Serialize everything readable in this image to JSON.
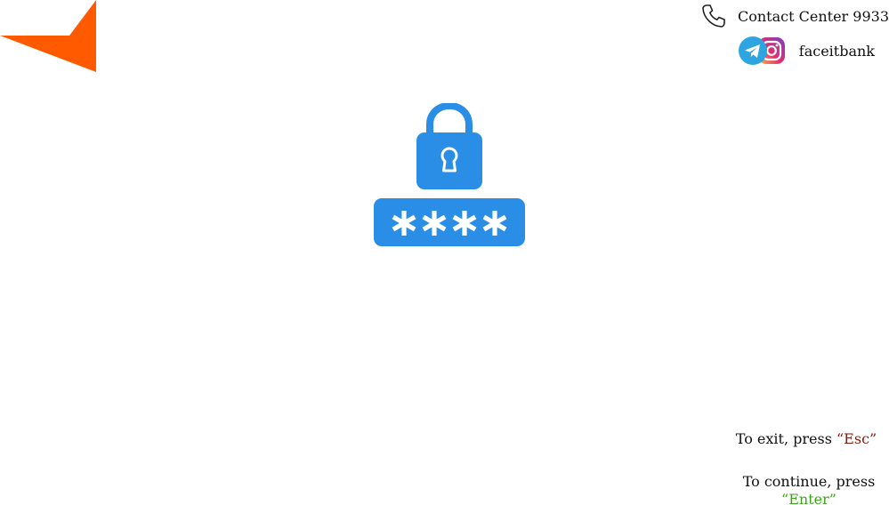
{
  "brand": {
    "accent_color": "#ff5a00",
    "logo_icon": "arrow-chevron-logo"
  },
  "contact": {
    "icon": "phone-icon",
    "label": "Contact Center 9933"
  },
  "social": {
    "icons": [
      "telegram-icon",
      "instagram-icon"
    ],
    "handle": "faceitbank"
  },
  "main": {
    "illustration": "lock-pin-icon",
    "accent_color": "#2a8ee6",
    "pin_mask": "****"
  },
  "hints": {
    "exit_prefix": "To exit, press",
    "exit_key": "“Esc”",
    "continue_prefix": "To continue, press",
    "continue_key": "“Enter”"
  }
}
